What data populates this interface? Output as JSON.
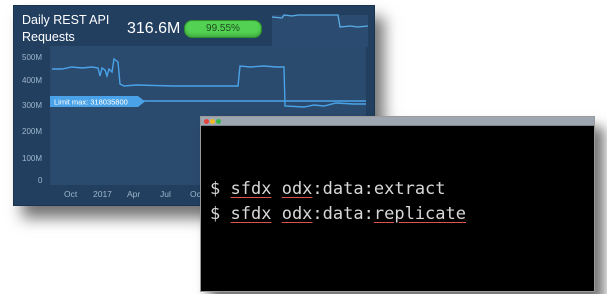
{
  "dashboard": {
    "title": "Daily REST API Requests",
    "total": "316.6M",
    "percent_label": "99.55%",
    "percent_value": 99.55,
    "accent_color": "#52d152",
    "line_color": "#4aa3e8",
    "y_ticks": [
      "500M",
      "400M",
      "300M",
      "200M",
      "100M",
      "0"
    ],
    "x_ticks": [
      "Oct",
      "2017",
      "Apr",
      "Jul",
      "Oc"
    ],
    "limit_label": "Limit max: 318035800",
    "limit_value": 318035800
  },
  "terminal": {
    "window_buttons": [
      "close",
      "minimize",
      "maximize"
    ],
    "lines": [
      {
        "prompt": "$",
        "tokens": [
          "sfdx",
          "odx",
          ":",
          "data",
          ":",
          "extract"
        ]
      },
      {
        "prompt": "$",
        "tokens": [
          "sfdx",
          "odx",
          ":",
          "data",
          ":",
          "replicate"
        ]
      }
    ]
  }
}
